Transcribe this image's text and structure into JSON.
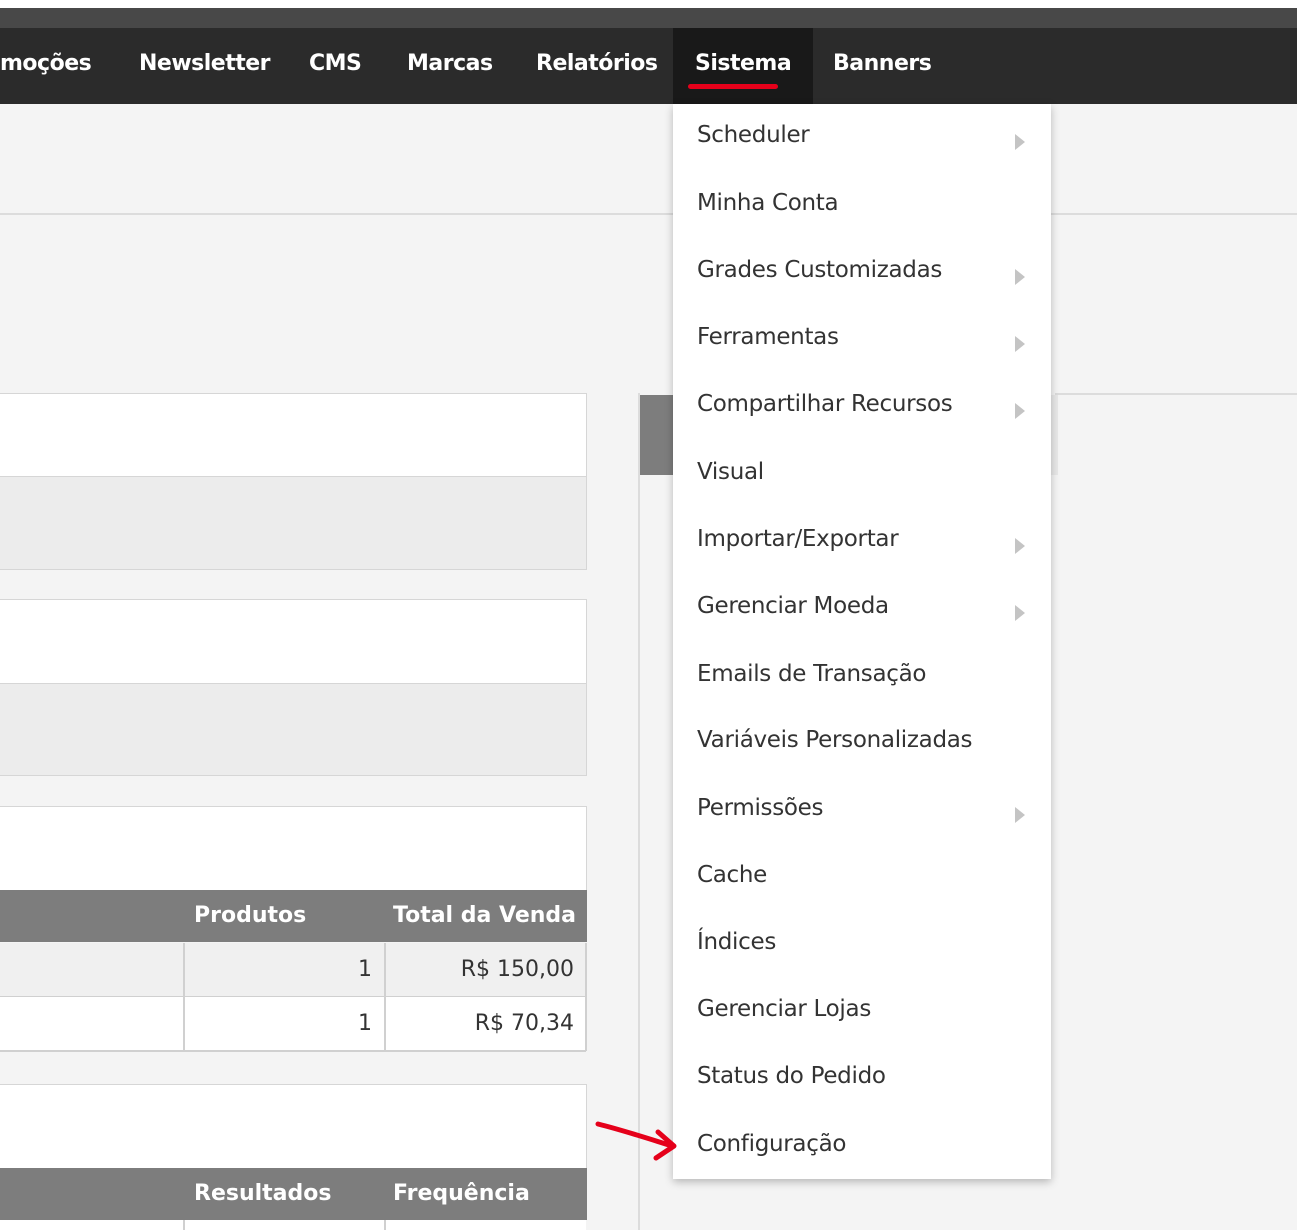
{
  "nav": {
    "items": [
      "moções",
      "Newsletter",
      "CMS",
      "Marcas",
      "Relatórios",
      "Sistema",
      "Banners"
    ],
    "active": "Sistema",
    "accent_color": "#e5001a"
  },
  "dropdown": {
    "items": [
      {
        "label": "Scheduler",
        "has_submenu": true
      },
      {
        "label": "Minha Conta",
        "has_submenu": false
      },
      {
        "label": "Grades Customizadas",
        "has_submenu": true
      },
      {
        "label": "Ferramentas",
        "has_submenu": true
      },
      {
        "label": "Compartilhar Recursos",
        "has_submenu": true
      },
      {
        "label": "Visual",
        "has_submenu": false
      },
      {
        "label": "Importar/Exportar",
        "has_submenu": true
      },
      {
        "label": "Gerenciar Moeda",
        "has_submenu": true
      },
      {
        "label": "Emails de Transação",
        "has_submenu": false
      },
      {
        "label": "Variáveis Personalizadas",
        "has_submenu": false
      },
      {
        "label": "Permissões",
        "has_submenu": true
      },
      {
        "label": "Cache",
        "has_submenu": false
      },
      {
        "label": "Índices",
        "has_submenu": false
      },
      {
        "label": "Gerenciar Lojas",
        "has_submenu": false
      },
      {
        "label": "Status do Pedido",
        "has_submenu": false
      },
      {
        "label": "Configuração",
        "has_submenu": false
      }
    ]
  },
  "orders_table": {
    "headers": {
      "products": "Produtos",
      "total": "Total da Venda"
    },
    "rows": [
      {
        "products": "1",
        "total": "R$ 150,00"
      },
      {
        "products": "1",
        "total": "R$ 70,34"
      }
    ]
  },
  "search_table": {
    "headers": {
      "results": "Resultados",
      "frequency": "Frequência"
    }
  },
  "annotation": {
    "arrow_color": "#e5001a"
  }
}
